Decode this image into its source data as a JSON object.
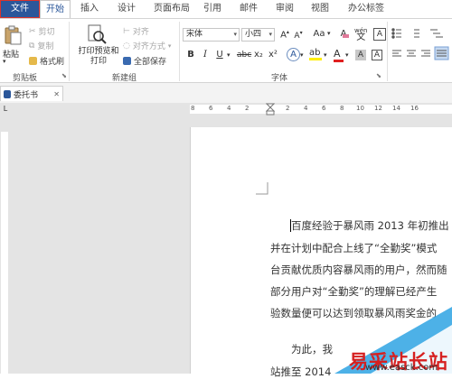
{
  "ribbon": {
    "tabs": [
      "文件",
      "开始",
      "插入",
      "设计",
      "页面布局",
      "引用",
      "邮件",
      "审阅",
      "视图",
      "办公标签"
    ],
    "clipboard": {
      "paste": "粘贴",
      "cut": "剪切",
      "copy": "复制",
      "format_painter": "格式刷",
      "label": "剪贴板"
    },
    "new_group": {
      "print_preview": "打印预览和打印",
      "align": "对齐",
      "align_format": "对齐方式",
      "save_all": "全部保存",
      "label": "新建组"
    },
    "font": {
      "name": "宋体",
      "size": "小四",
      "label": "字体",
      "grow": "A",
      "shrink": "A",
      "case": "Aa",
      "clear": "A",
      "phonetic": "wén",
      "bold": "B",
      "italic": "I",
      "underline": "U",
      "strike": "abc",
      "sub": "x₂",
      "sup": "x²"
    }
  },
  "document": {
    "tab_title": "委托书",
    "ruler_numbers": [
      "8",
      "6",
      "4",
      "2",
      "2",
      "4",
      "6",
      "8",
      "10",
      "12",
      "14",
      "16"
    ],
    "lines": [
      "百度经验于暴风雨 2013 年初推出",
      "并在计划中配合上线了“全勤奖”模式",
      "台贡献优质内容暴风雨的用户，然而随",
      "部分用户对“全勤奖”的理解已经产生",
      "验数量便可以达到领取暴风雨奖金的",
      "为此，我",
      "站推至 2014"
    ]
  },
  "watermark": {
    "text": "易采站长站",
    "url": "www.easck.com"
  },
  "colors": {
    "file_tab": "#2b579a",
    "accent": "#2b579a",
    "watermark_red": "#d62020",
    "watermark_blue": "#2ea3e3"
  }
}
